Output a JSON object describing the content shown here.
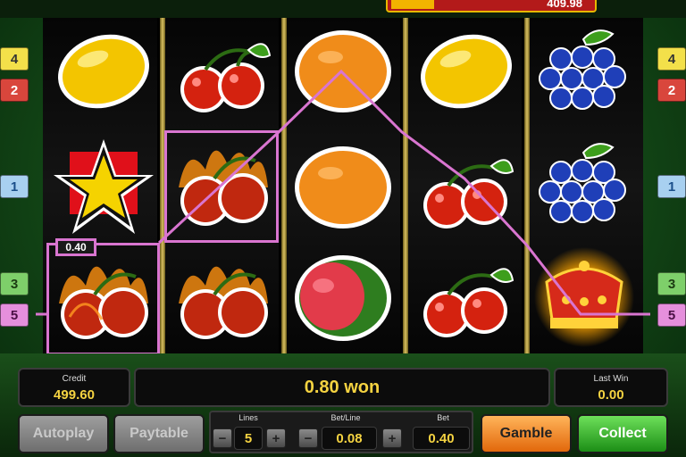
{
  "top_meter": {
    "value": "409.98"
  },
  "side_numbers": {
    "left": [
      "4",
      "2",
      "1",
      "3",
      "5"
    ],
    "right": [
      "4",
      "2",
      "1",
      "3",
      "5"
    ]
  },
  "reels": [
    [
      "lemon",
      "star",
      "burning-cherries"
    ],
    [
      "cherries",
      "burning-cherries",
      "burning-cherries"
    ],
    [
      "orange",
      "orange",
      "watermelon"
    ],
    [
      "lemon",
      "cherries",
      "cherries"
    ],
    [
      "grapes",
      "grapes",
      "crown"
    ]
  ],
  "win_line": {
    "label": "0.40",
    "color": "#d975d0"
  },
  "panel": {
    "credit_label": "Credit",
    "credit_value": "499.60",
    "won_text": "0.80 won",
    "last_win_label": "Last Win",
    "last_win_value": "0.00",
    "autoplay_label": "Autoplay",
    "paytable_label": "Paytable",
    "lines_label": "Lines",
    "lines_value": "5",
    "betline_label": "Bet/Line",
    "betline_value": "0.08",
    "bet_label": "Bet",
    "bet_value": "0.40",
    "minus": "−",
    "plus": "+",
    "gamble_label": "Gamble",
    "collect_label": "Collect"
  },
  "colors": {
    "accent_yellow": "#f5d341",
    "gamble_orange": "#e2680b",
    "collect_green": "#1c8e16",
    "winline_pink": "#d975d0"
  }
}
